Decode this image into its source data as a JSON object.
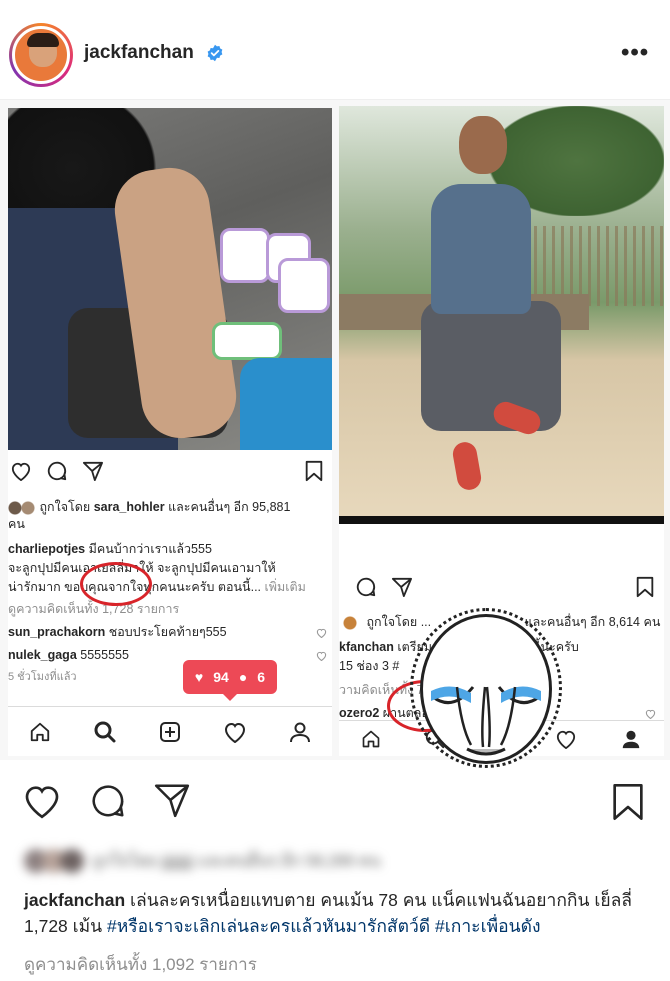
{
  "header": {
    "username": "jackfanchan",
    "more_label": "•••"
  },
  "left_screenshot": {
    "liked_by_prefix": "ถูกใจโดย",
    "liked_by_user": "sara_hohler",
    "liked_by_suffix": "และคนอื่นๆ อีก 95,881",
    "liked_by_suffix2": "คน",
    "caption_user": "charliepotjes",
    "caption_line1": "มีคนบ้ากว่าเราแล้ว555",
    "caption_line2": "จะลูกปุปมีคนเอาเยลลี่มาให้ จะลูกปุปมีคนเอามาให้",
    "caption_line3": "น่ารักมาก ขอบคุณจากใจทุกคนนะครับ ตอนนี้...",
    "caption_more": "เพิ่มเติม",
    "view_comments": "ดูความคิดเห็นทั้ง 1,728 รายการ",
    "comment1_user": "sun_prachakorn",
    "comment1_text": "ชอบประโยคท้ายๆ555",
    "comment2_user": "nulek_gaga",
    "comment2_text": "5555555",
    "time": "5 ชั่วโมงที่แล้ว",
    "notif_likes": "94",
    "notif_follows": "6"
  },
  "right_screenshot": {
    "liked_by_prefix": "ถูกใจโดย",
    "liked_by_suffix": "และคนอื่นๆ อีก 8,614 คน",
    "caption_user": "kfanchan",
    "caption_text": "เตรียม...",
    "caption_tail": "...วันนี้นะครับ",
    "caption_line2": "15 ช่อง 3 #",
    "view_comments": "วามคิดเห็นทั้ง 78 รายการ",
    "comment_user": "ozero2",
    "comment_text": "ผ่านตลอดเลยครับ"
  },
  "caption": {
    "user": "jackfanchan",
    "text": " เล่นละครเหนื่อยแทบตาย คนเม้น 78 คน แน็คแฟนฉันอยากกิน เย็ลลี่ 1,728 เม้น ",
    "tag1": "#หรือเราจะเลิกเล่นละครแล้วหันมารักสัตว์ดี",
    "tag2": "#เกาะเพื่อนดัง"
  },
  "liked_by_blurred": "ถูกใจโดย jjjjjjjjj และคนอื่นๆ อีก 58,289 คน",
  "view_comments": "ดูความคิดเห็นทั้ง 1,092 รายการ",
  "colors": {
    "accent_red": "#ed4956",
    "circle_red": "#d8242a",
    "link_blue": "#003569",
    "verified_blue": "#3897f0"
  },
  "icons": [
    "heart-icon",
    "comment-icon",
    "share-icon",
    "bookmark-icon",
    "home-icon",
    "search-icon",
    "add-icon",
    "activity-icon",
    "profile-icon"
  ]
}
